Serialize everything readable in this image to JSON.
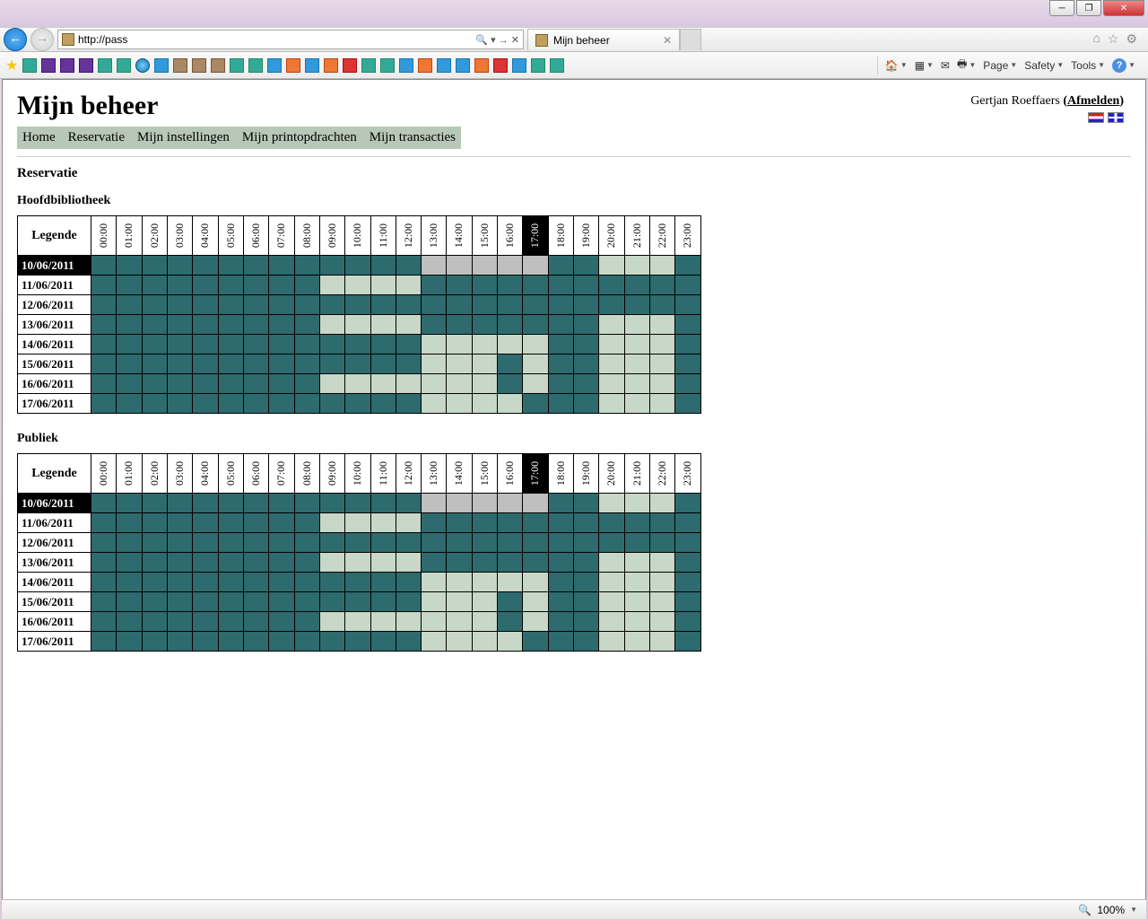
{
  "browser": {
    "url": "http://pass",
    "tab_title": "Mijn beheer",
    "cmd": {
      "page": "Page",
      "safety": "Safety",
      "tools": "Tools"
    },
    "zoom": "100%"
  },
  "page": {
    "title": "Mijn beheer",
    "user": "Gertjan Roeffaers",
    "logout": "Afmelden",
    "menu": [
      "Home",
      "Reservatie",
      "Mijn instellingen",
      "Mijn printopdrachten",
      "Mijn transacties"
    ],
    "section": "Reservatie",
    "legend_label": "Legende",
    "hours": [
      "00:00",
      "01:00",
      "02:00",
      "03:00",
      "04:00",
      "05:00",
      "06:00",
      "07:00",
      "08:00",
      "09:00",
      "10:00",
      "11:00",
      "12:00",
      "13:00",
      "14:00",
      "15:00",
      "16:00",
      "17:00",
      "18:00",
      "19:00",
      "20:00",
      "21:00",
      "22:00",
      "23:00"
    ],
    "current_hour_index": 17,
    "tables": [
      {
        "title": "Hoofdbibliotheek",
        "rows": [
          {
            "date": "10/06/2011",
            "current": true,
            "cells": [
              "teal",
              "teal",
              "teal",
              "teal",
              "teal",
              "teal",
              "teal",
              "teal",
              "teal",
              "teal",
              "teal",
              "teal",
              "teal",
              "gray",
              "gray",
              "gray",
              "gray",
              "gray",
              "teal",
              "teal",
              "pale",
              "pale",
              "pale",
              "teal"
            ]
          },
          {
            "date": "11/06/2011",
            "current": false,
            "cells": [
              "teal",
              "teal",
              "teal",
              "teal",
              "teal",
              "teal",
              "teal",
              "teal",
              "teal",
              "pale",
              "pale",
              "pale",
              "pale",
              "teal",
              "teal",
              "teal",
              "teal",
              "teal",
              "teal",
              "teal",
              "teal",
              "teal",
              "teal",
              "teal"
            ]
          },
          {
            "date": "12/06/2011",
            "current": false,
            "cells": [
              "teal",
              "teal",
              "teal",
              "teal",
              "teal",
              "teal",
              "teal",
              "teal",
              "teal",
              "teal",
              "teal",
              "teal",
              "teal",
              "teal",
              "teal",
              "teal",
              "teal",
              "teal",
              "teal",
              "teal",
              "teal",
              "teal",
              "teal",
              "teal"
            ]
          },
          {
            "date": "13/06/2011",
            "current": false,
            "cells": [
              "teal",
              "teal",
              "teal",
              "teal",
              "teal",
              "teal",
              "teal",
              "teal",
              "teal",
              "pale",
              "pale",
              "pale",
              "pale",
              "teal",
              "teal",
              "teal",
              "teal",
              "teal",
              "teal",
              "teal",
              "pale",
              "pale",
              "pale",
              "teal"
            ]
          },
          {
            "date": "14/06/2011",
            "current": false,
            "cells": [
              "teal",
              "teal",
              "teal",
              "teal",
              "teal",
              "teal",
              "teal",
              "teal",
              "teal",
              "teal",
              "teal",
              "teal",
              "teal",
              "pale",
              "pale",
              "pale",
              "pale",
              "pale",
              "teal",
              "teal",
              "pale",
              "pale",
              "pale",
              "teal"
            ]
          },
          {
            "date": "15/06/2011",
            "current": false,
            "cells": [
              "teal",
              "teal",
              "teal",
              "teal",
              "teal",
              "teal",
              "teal",
              "teal",
              "teal",
              "teal",
              "teal",
              "teal",
              "teal",
              "pale",
              "pale",
              "pale",
              "teal",
              "pale",
              "teal",
              "teal",
              "pale",
              "pale",
              "pale",
              "teal"
            ]
          },
          {
            "date": "16/06/2011",
            "current": false,
            "cells": [
              "teal",
              "teal",
              "teal",
              "teal",
              "teal",
              "teal",
              "teal",
              "teal",
              "teal",
              "pale",
              "pale",
              "pale",
              "pale",
              "pale",
              "pale",
              "pale",
              "teal",
              "pale",
              "teal",
              "teal",
              "pale",
              "pale",
              "pale",
              "teal"
            ]
          },
          {
            "date": "17/06/2011",
            "current": false,
            "cells": [
              "teal",
              "teal",
              "teal",
              "teal",
              "teal",
              "teal",
              "teal",
              "teal",
              "teal",
              "teal",
              "teal",
              "teal",
              "teal",
              "pale",
              "pale",
              "pale",
              "pale",
              "teal",
              "teal",
              "teal",
              "pale",
              "pale",
              "pale",
              "teal"
            ]
          }
        ]
      },
      {
        "title": "Publiek",
        "rows": [
          {
            "date": "10/06/2011",
            "current": true,
            "cells": [
              "teal",
              "teal",
              "teal",
              "teal",
              "teal",
              "teal",
              "teal",
              "teal",
              "teal",
              "teal",
              "teal",
              "teal",
              "teal",
              "gray",
              "gray",
              "gray",
              "gray",
              "gray",
              "teal",
              "teal",
              "pale",
              "pale",
              "pale",
              "teal"
            ]
          },
          {
            "date": "11/06/2011",
            "current": false,
            "cells": [
              "teal",
              "teal",
              "teal",
              "teal",
              "teal",
              "teal",
              "teal",
              "teal",
              "teal",
              "pale",
              "pale",
              "pale",
              "pale",
              "teal",
              "teal",
              "teal",
              "teal",
              "teal",
              "teal",
              "teal",
              "teal",
              "teal",
              "teal",
              "teal"
            ]
          },
          {
            "date": "12/06/2011",
            "current": false,
            "cells": [
              "teal",
              "teal",
              "teal",
              "teal",
              "teal",
              "teal",
              "teal",
              "teal",
              "teal",
              "teal",
              "teal",
              "teal",
              "teal",
              "teal",
              "teal",
              "teal",
              "teal",
              "teal",
              "teal",
              "teal",
              "teal",
              "teal",
              "teal",
              "teal"
            ]
          },
          {
            "date": "13/06/2011",
            "current": false,
            "cells": [
              "teal",
              "teal",
              "teal",
              "teal",
              "teal",
              "teal",
              "teal",
              "teal",
              "teal",
              "pale",
              "pale",
              "pale",
              "pale",
              "teal",
              "teal",
              "teal",
              "teal",
              "teal",
              "teal",
              "teal",
              "pale",
              "pale",
              "pale",
              "teal"
            ]
          },
          {
            "date": "14/06/2011",
            "current": false,
            "cells": [
              "teal",
              "teal",
              "teal",
              "teal",
              "teal",
              "teal",
              "teal",
              "teal",
              "teal",
              "teal",
              "teal",
              "teal",
              "teal",
              "pale",
              "pale",
              "pale",
              "pale",
              "pale",
              "teal",
              "teal",
              "pale",
              "pale",
              "pale",
              "teal"
            ]
          },
          {
            "date": "15/06/2011",
            "current": false,
            "cells": [
              "teal",
              "teal",
              "teal",
              "teal",
              "teal",
              "teal",
              "teal",
              "teal",
              "teal",
              "teal",
              "teal",
              "teal",
              "teal",
              "pale",
              "pale",
              "pale",
              "teal",
              "pale",
              "teal",
              "teal",
              "pale",
              "pale",
              "pale",
              "teal"
            ]
          },
          {
            "date": "16/06/2011",
            "current": false,
            "cells": [
              "teal",
              "teal",
              "teal",
              "teal",
              "teal",
              "teal",
              "teal",
              "teal",
              "teal",
              "pale",
              "pale",
              "pale",
              "pale",
              "pale",
              "pale",
              "pale",
              "teal",
              "pale",
              "teal",
              "teal",
              "pale",
              "pale",
              "pale",
              "teal"
            ]
          },
          {
            "date": "17/06/2011",
            "current": false,
            "cells": [
              "teal",
              "teal",
              "teal",
              "teal",
              "teal",
              "teal",
              "teal",
              "teal",
              "teal",
              "teal",
              "teal",
              "teal",
              "teal",
              "pale",
              "pale",
              "pale",
              "pale",
              "teal",
              "teal",
              "teal",
              "pale",
              "pale",
              "pale",
              "teal"
            ]
          }
        ]
      }
    ]
  }
}
